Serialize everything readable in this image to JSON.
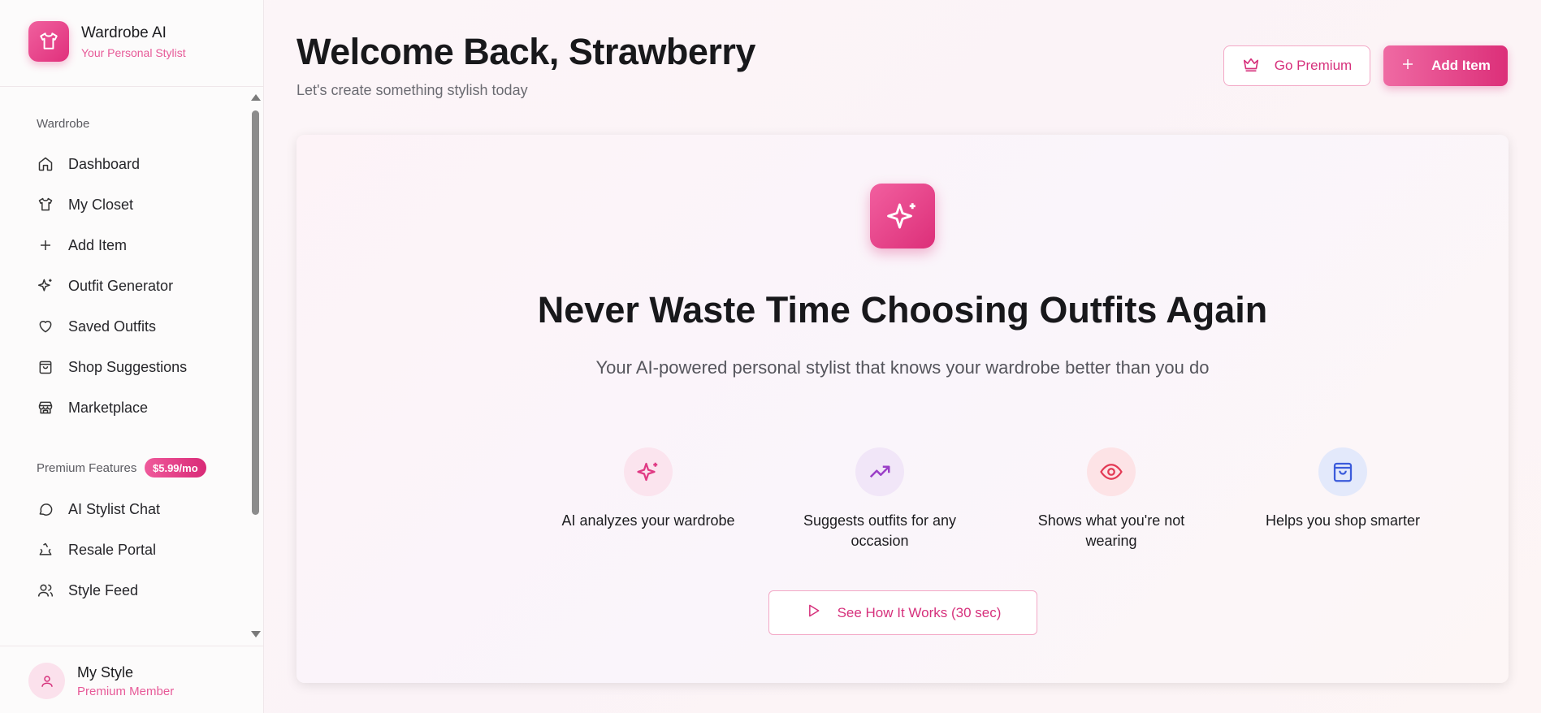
{
  "brand": {
    "title": "Wardrobe AI",
    "subtitle": "Your Personal Stylist"
  },
  "sidebar": {
    "section_wardrobe": "Wardrobe",
    "items": [
      {
        "label": "Dashboard",
        "icon": "home-icon"
      },
      {
        "label": "My Closet",
        "icon": "shirt-icon"
      },
      {
        "label": "Add Item",
        "icon": "plus-icon"
      },
      {
        "label": "Outfit Generator",
        "icon": "sparkles-icon"
      },
      {
        "label": "Saved Outfits",
        "icon": "heart-icon"
      },
      {
        "label": "Shop Suggestions",
        "icon": "shopping-bag-icon"
      },
      {
        "label": "Marketplace",
        "icon": "store-icon"
      }
    ],
    "section_premium": "Premium Features",
    "premium_price": "$5.99/mo",
    "premium_items": [
      {
        "label": "AI Stylist Chat",
        "icon": "chat-icon"
      },
      {
        "label": "Resale Portal",
        "icon": "recycle-icon"
      },
      {
        "label": "Style Feed",
        "icon": "users-icon"
      }
    ]
  },
  "user": {
    "name": "My Style",
    "role": "Premium Member"
  },
  "header": {
    "title": "Welcome Back, Strawberry",
    "subtitle": "Let's create something stylish today",
    "premium_label": "Go Premium",
    "add_label": "Add Item"
  },
  "hero": {
    "title": "Never Waste Time Choosing Outfits Again",
    "subtitle": "Your AI-powered personal stylist that knows your wardrobe better than you do",
    "features": [
      {
        "label": "AI analyzes your wardrobe",
        "icon": "sparkles-icon",
        "color": "#e03a84",
        "bg": "#fbe4ee"
      },
      {
        "label": "Suggests outfits for any occasion",
        "icon": "trending-up-icon",
        "color": "#9b3fc7",
        "bg": "#f1e6f8"
      },
      {
        "label": "Shows what you're not wearing",
        "icon": "eye-icon",
        "color": "#e33a55",
        "bg": "#fde3e6"
      },
      {
        "label": "Helps you shop smarter",
        "icon": "shopping-bag-icon",
        "color": "#3b5bdb",
        "bg": "#e3e9fb"
      }
    ],
    "cta_label": "See How It Works (30 sec)"
  },
  "colors": {
    "accent": "#dc2f79",
    "accent_light": "#f3a8c6"
  }
}
